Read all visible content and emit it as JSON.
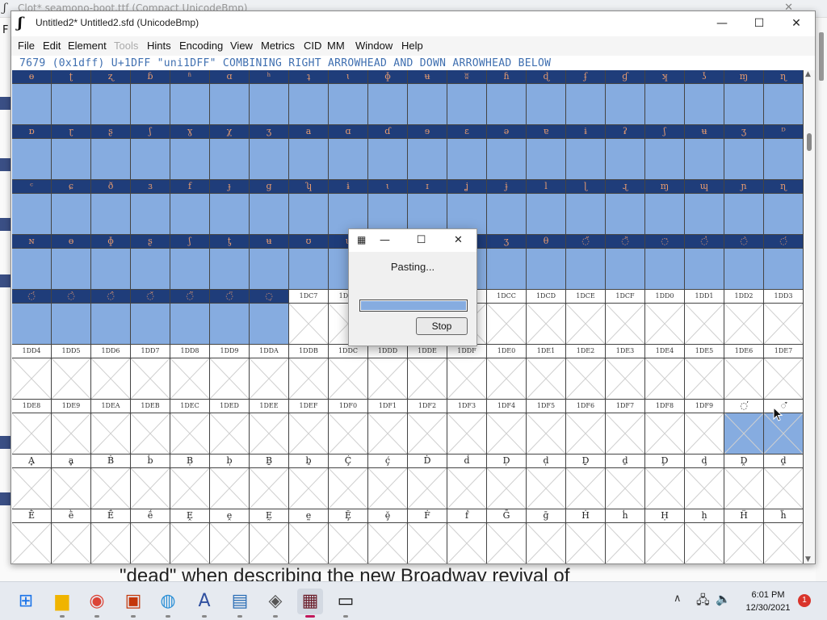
{
  "background_window": {
    "title": "Clot* seamono-boot.ttf (Compact UnicodeBmp)",
    "menu_letter": "F",
    "text_snippet": "\"dead\" when describing the new Broadway revival of"
  },
  "window": {
    "title": "Untitled2*  Untitled2.sfd (UnicodeBmp)",
    "app_icon": "fontforge-icon",
    "minimize_label": "—",
    "maximize_label": "☐",
    "close_label": "✕"
  },
  "menubar": {
    "items": [
      {
        "label": "File",
        "disabled": false
      },
      {
        "label": "Edit",
        "disabled": false
      },
      {
        "label": "Element",
        "disabled": false
      },
      {
        "label": "Tools",
        "disabled": true
      },
      {
        "label": "Hints",
        "disabled": false
      },
      {
        "label": "Encoding",
        "disabled": false
      },
      {
        "label": "View",
        "disabled": false
      },
      {
        "label": "Metrics",
        "disabled": false
      },
      {
        "label": "CID",
        "disabled": false
      },
      {
        "label": "MM",
        "disabled": false
      },
      {
        "label": "Window",
        "disabled": false
      },
      {
        "label": "Help",
        "disabled": false
      }
    ]
  },
  "info_line": "7679 (0x1dff) U+1DFF \"uni1DFF\" COMBINING RIGHT ARROWHEAD AND DOWN ARROWHEAD BELOW",
  "glyph_grid": {
    "rows": [
      {
        "cells": [
          "ɵ",
          "ʈ",
          "ʐ",
          "ɓ",
          "ʱ",
          "ɑ",
          "ʰ",
          "ʇ",
          "ɩ",
          "ɸ",
          "ʉ",
          "ʬ",
          "ɦ",
          "ɖ",
          "ʄ",
          "ɠ",
          "ʞ",
          "ʖ",
          "ɱ",
          "ɳ"
        ],
        "state": "selected"
      },
      {
        "cells": [
          "ɒ",
          "ɽ",
          "ʂ",
          "ʃ",
          "ɣ",
          "χ",
          "ʒ",
          "a",
          "ɑ",
          "ɗ",
          "ɘ",
          "ɛ",
          "ə",
          "ɐ",
          "ɨ",
          "ʡ",
          "ʃ",
          "ʉ",
          "ʒ",
          "ᴰ"
        ],
        "state": "selected"
      },
      {
        "cells": [
          "ᶜ",
          "ɕ",
          "ð",
          "ɜ",
          "f",
          "ɟ",
          "g",
          "ʮ",
          "ɨ",
          "ɩ",
          "ɪ",
          "ʝ",
          "ɉ",
          "l",
          "ɭ",
          "ɻ",
          "ɱ",
          "ɰ",
          "ɲ",
          "ɳ"
        ],
        "state": "selected"
      },
      {
        "cells": [
          "ɴ",
          "ɵ",
          "ɸ",
          "ʂ",
          "ʃ",
          "ƫ",
          "ʉ",
          "ʊ",
          "ʋ",
          "ʌ",
          "ʐ",
          "ʑ",
          "ʒ",
          "θ",
          "◌̋",
          "◌̏",
          "◌̒",
          "◌̓",
          "◌̀",
          "◌́"
        ],
        "state": "selected"
      },
      {
        "cells": [
          "◌́",
          "◌̀",
          "◌̂",
          "◌̌",
          "◌̃",
          "◌̈",
          "◌̦",
          "1DC7",
          "1DC8",
          "1DC9",
          "1DCA",
          "1DCB",
          "1DCC",
          "1DCD",
          "1DCE",
          "1DCF",
          "1DD0",
          "1DD1",
          "1DD2",
          "1DD3"
        ],
        "state": "mixed"
      },
      {
        "cells": [
          "1DD4",
          "1DD5",
          "1DD6",
          "1DD7",
          "1DD8",
          "1DD9",
          "1DDA",
          "1DDB",
          "1DDC",
          "1DDD",
          "1DDE",
          "1DDF",
          "1DE0",
          "1DE1",
          "1DE2",
          "1DE3",
          "1DE4",
          "1DE5",
          "1DE6",
          "1DE7"
        ],
        "state": "empty"
      },
      {
        "cells": [
          "1DE8",
          "1DE9",
          "1DEA",
          "1DEB",
          "1DEC",
          "1DED",
          "1DEE",
          "1DEF",
          "1DF0",
          "1DF1",
          "1DF2",
          "1DF3",
          "1DF4",
          "1DF5",
          "1DF6",
          "1DF7",
          "1DF8",
          "1DF9",
          "◌̕",
          "◌͒"
        ],
        "state": "empty-lastsel"
      },
      {
        "cells": [
          "Ḁ",
          "ḁ",
          "Ḃ",
          "ḃ",
          "Ḅ",
          "ḅ",
          "Ḇ",
          "ḇ",
          "Ḉ",
          "ḉ",
          "Ḋ",
          "ḋ",
          "Ḍ",
          "ḍ",
          "Ḏ",
          "ḏ",
          "Ḑ",
          "ḑ",
          "Ḓ",
          "ḓ"
        ],
        "state": "empty"
      },
      {
        "cells": [
          "Ḕ",
          "ḕ",
          "Ḗ",
          "ḗ",
          "Ḙ",
          "ḙ",
          "Ḛ",
          "ḛ",
          "Ḝ",
          "ḝ",
          "Ḟ",
          "ḟ",
          "Ḡ",
          "ḡ",
          "Ḣ",
          "ḣ",
          "Ḥ",
          "ḥ",
          "Ḧ",
          "ḧ"
        ],
        "state": "empty"
      }
    ],
    "mixed_selected_count": 7
  },
  "dialog": {
    "icon": "fontforge-small-icon",
    "message": "Pasting...",
    "progress": 1.0,
    "stop_label": "Stop"
  },
  "taskbar": {
    "apps": [
      "start",
      "file-explorer",
      "chrome",
      "store",
      "paint",
      "fontforge-a",
      "notepad",
      "script-editor",
      "fontforge",
      "terminal"
    ],
    "active_app": "fontforge",
    "clock_time": "6:01 PM",
    "clock_date": "12/30/2021",
    "notification_count": "1"
  },
  "colors": {
    "selection_label_bg": "#1f3d7a",
    "selection_label_fg": "#e79a6e",
    "selection_cell_bg": "#86ace0",
    "info_text": "#3f6fb0"
  }
}
